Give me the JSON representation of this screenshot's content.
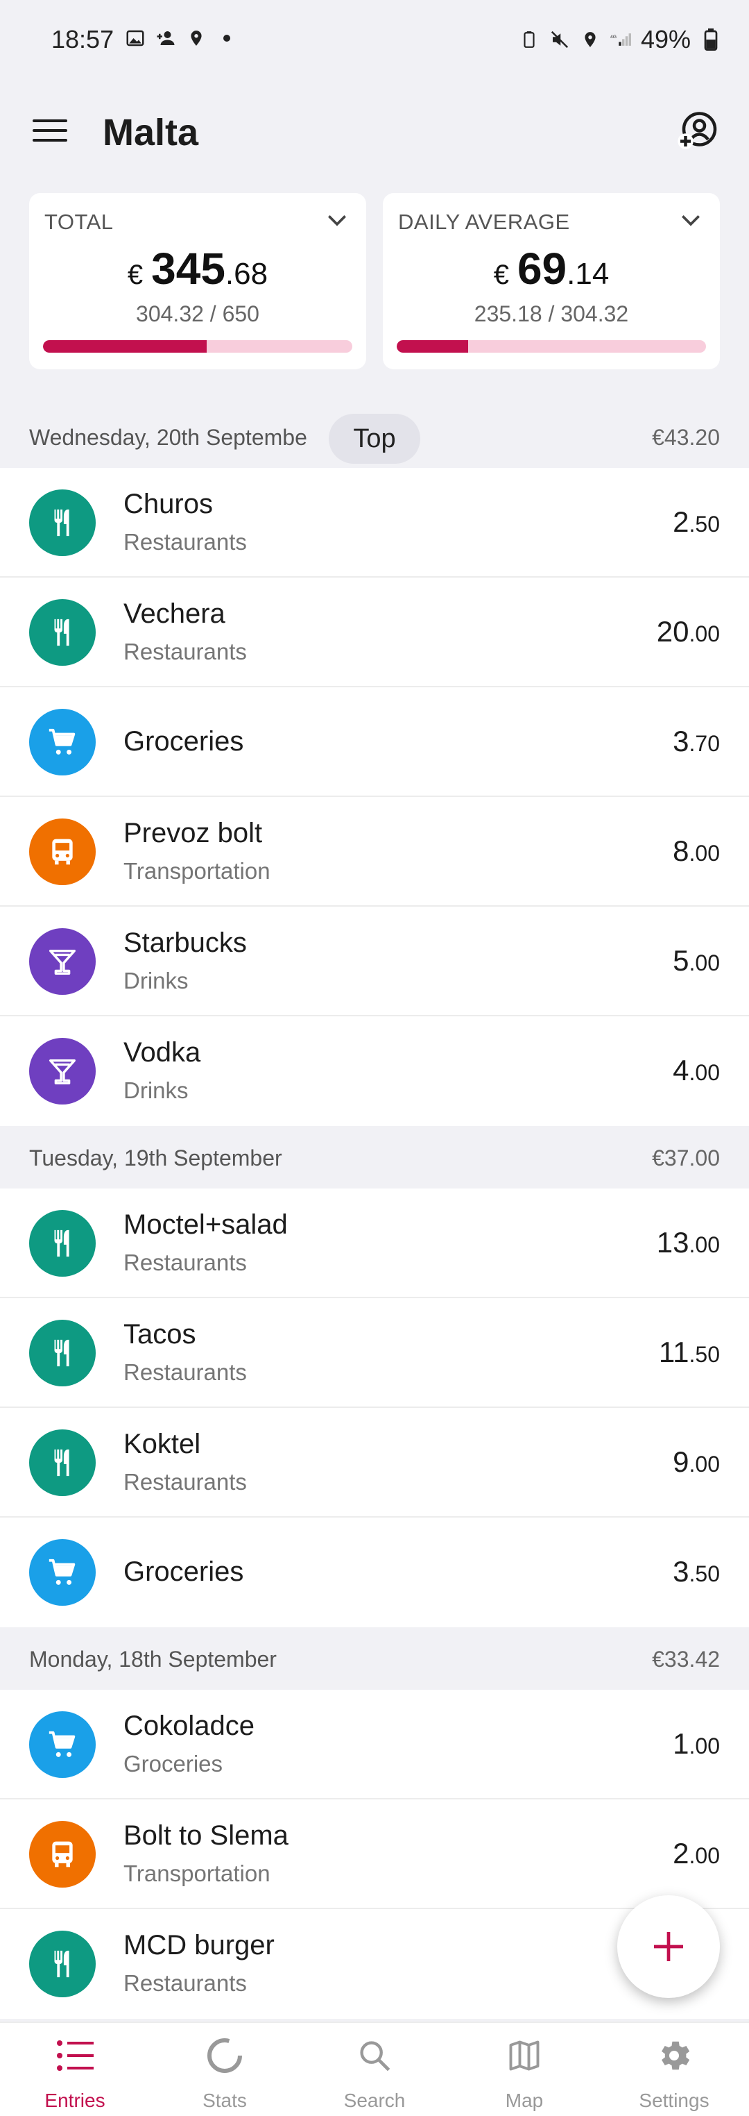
{
  "status_bar": {
    "time": "18:57",
    "battery": "49%"
  },
  "app_bar": {
    "title": "Malta"
  },
  "cards": [
    {
      "label": "TOTAL",
      "currency": "€",
      "whole": "345",
      "decimal": ".68",
      "spent": "304.32",
      "budget": "650",
      "progress": 0.53
    },
    {
      "label": "DAILY AVERAGE",
      "currency": "€",
      "whole": "69",
      "decimal": ".14",
      "spent": "235.18",
      "budget": "304.32",
      "progress": 0.23
    }
  ],
  "top_chip": "Top",
  "days": [
    {
      "title": "Wednesday, 20th Septembe",
      "total": "€43.20",
      "entries": [
        {
          "name": "Churos",
          "category": "Restaurants",
          "whole": "2",
          "decimal": ".50",
          "icon": "restaurant-icon",
          "color": "#0e9a82"
        },
        {
          "name": "Vechera",
          "category": "Restaurants",
          "whole": "20",
          "decimal": ".00",
          "icon": "restaurant-icon",
          "color": "#0e9a82"
        },
        {
          "name": "Groceries",
          "category": "",
          "whole": "3",
          "decimal": ".70",
          "icon": "cart-icon",
          "color": "#1aa0e8"
        },
        {
          "name": "Prevoz bolt",
          "category": "Transportation",
          "whole": "8",
          "decimal": ".00",
          "icon": "bus-icon",
          "color": "#f07000"
        },
        {
          "name": "Starbucks",
          "category": "Drinks",
          "whole": "5",
          "decimal": ".00",
          "icon": "cocktail-icon",
          "color": "#6f3fc0"
        },
        {
          "name": "Vodka",
          "category": "Drinks",
          "whole": "4",
          "decimal": ".00",
          "icon": "cocktail-icon",
          "color": "#6f3fc0"
        }
      ]
    },
    {
      "title": "Tuesday, 19th September",
      "total": "€37.00",
      "entries": [
        {
          "name": "Moctel+salad",
          "category": "Restaurants",
          "whole": "13",
          "decimal": ".00",
          "icon": "restaurant-icon",
          "color": "#0e9a82"
        },
        {
          "name": "Tacos",
          "category": "Restaurants",
          "whole": "11",
          "decimal": ".50",
          "icon": "restaurant-icon",
          "color": "#0e9a82"
        },
        {
          "name": "Koktel",
          "category": "Restaurants",
          "whole": "9",
          "decimal": ".00",
          "icon": "restaurant-icon",
          "color": "#0e9a82"
        },
        {
          "name": "Groceries",
          "category": "",
          "whole": "3",
          "decimal": ".50",
          "icon": "cart-icon",
          "color": "#1aa0e8"
        }
      ]
    },
    {
      "title": "Monday, 18th September",
      "total": "€33.42",
      "entries": [
        {
          "name": "Cokoladce",
          "category": "Groceries",
          "whole": "1",
          "decimal": ".00",
          "icon": "cart-icon",
          "color": "#1aa0e8"
        },
        {
          "name": "Bolt to Slema",
          "category": "Transportation",
          "whole": "2",
          "decimal": ".00",
          "icon": "bus-icon",
          "color": "#f07000"
        },
        {
          "name": "MCD burger",
          "category": "Restaurants",
          "whole": "",
          "decimal": "",
          "icon": "restaurant-icon",
          "color": "#0e9a82"
        }
      ]
    }
  ],
  "bottom_nav": [
    {
      "label": "Entries",
      "icon": "list-icon",
      "active": true
    },
    {
      "label": "Stats",
      "icon": "stats-icon",
      "active": false
    },
    {
      "label": "Search",
      "icon": "search-icon",
      "active": false
    },
    {
      "label": "Map",
      "icon": "map-icon",
      "active": false
    },
    {
      "label": "Settings",
      "icon": "gear-icon",
      "active": false
    }
  ],
  "colors": {
    "accent": "#c2104e",
    "accent_light": "#f8cddc",
    "background": "#f1f1f5"
  }
}
